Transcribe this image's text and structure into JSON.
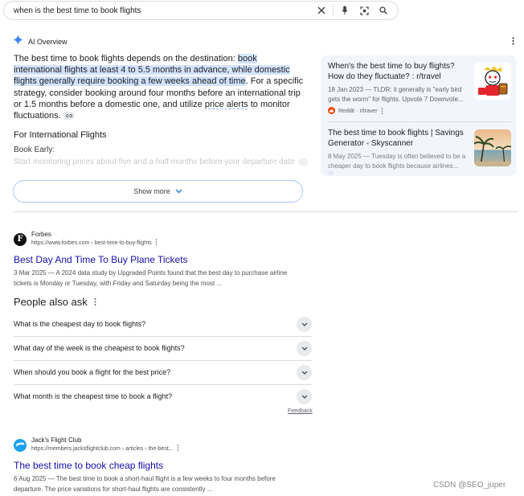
{
  "search": {
    "query": "when is the best time to book flights",
    "icons": [
      "close-icon",
      "microphone-icon",
      "lens-icon",
      "search-icon"
    ]
  },
  "ai_overview": {
    "title": "AI Overview",
    "para_1": "The best time to book flights depends on the destination: ",
    "para_highlight": "book international flights at least 4 to 5.5 months in advance, while domestic flights generally require booking a few weeks ahead of time",
    "para_2": ". For a specific strategy, consider booking around four months before an international trip or 1.5 months before a domestic one, and utilize ",
    "para_link": "price alerts",
    "para_3": " to monitor fluctuations.",
    "section_heading": "For International Flights",
    "sub_heading": "Book Early:",
    "faded_text": "Start monitoring prices about five and a half months before your departure date",
    "show_more": "Show more"
  },
  "sources": [
    {
      "title": "When's the best time to buy flights? How do they fluctuate? : r/travel",
      "snippet": "18 Jan 2023 — TLDR: it generally is \"early bird gets the worm\" for flights. Upvote 7 Downvote...",
      "site": "Reddit · r/traver"
    },
    {
      "title": "The best time to book flights | Savings Generator - Skyscanner",
      "snippet": "8 May 2025 — Tuesday is often believed to be a cheaper day to book flights because airlines..."
    }
  ],
  "results": [
    {
      "site_name": "Forbes",
      "url": "https://www.forbes.com › best-time-to-buy-flights",
      "title": "Best Day And Time To Buy Plane Tickets",
      "snippet": "3 Mar 2025 — A 2024 data study by Upgraded Points found that the best day to purchase airline tickets is Monday or Tuesday, with Friday and Saturday being the most ...",
      "favicon_letter": "F"
    },
    {
      "site_name": "Jack's Flight Club",
      "url": "https://members.jacksflightclub.com › articles › the-best...",
      "title": "The best time to book cheap flights",
      "snippet": "6 Aug 2025 — The best time to book a short-haul flight is a few weeks to four months before departure. The price variations for short-haul flights are consistently ..."
    }
  ],
  "people_also_ask": {
    "title": "People also ask",
    "questions": [
      "What is the cheapest day to book flights?",
      "What day of the week is the cheapest to book flights?",
      "When should you book a flight for the best price?",
      "What month is the cheapest time to book a flight?"
    ],
    "feedback": "Feedback"
  },
  "watermark": "CSDN @SEO_juper",
  "colors": {
    "link": "#1a0dab",
    "highlight": "#d3e3fd",
    "panel_bg": "#f2f6fc",
    "ai_accent": "#4285f4"
  }
}
